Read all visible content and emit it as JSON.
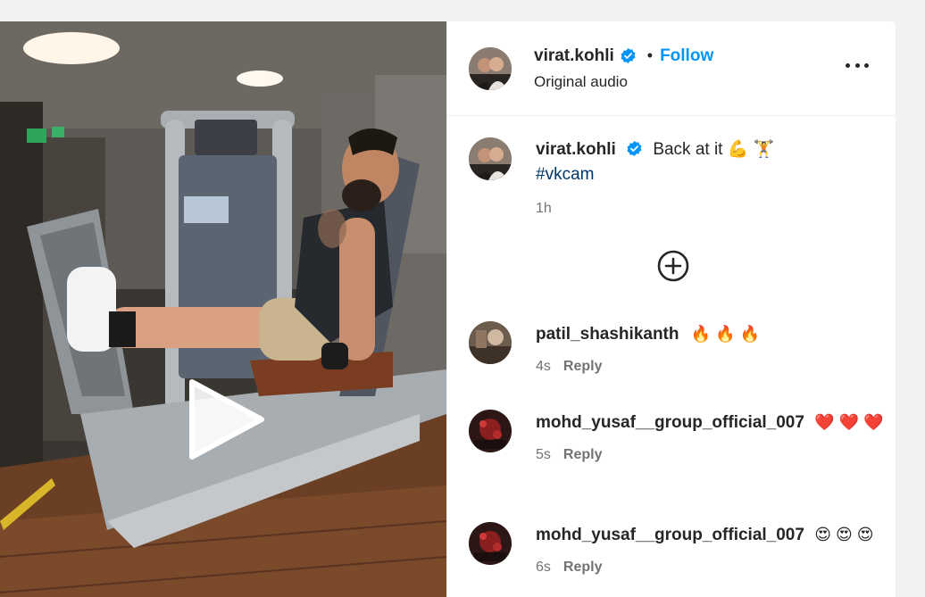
{
  "post": {
    "author": "virat.kohli",
    "follow_label": "Follow",
    "separator": "•",
    "audio": "Original audio",
    "caption": "Back at it 💪 🏋️",
    "hashtag": "#vkcam",
    "time": "1h"
  },
  "comments": [
    {
      "user": "patil_shashikanth",
      "text": "🔥 🔥 🔥",
      "time": "4s",
      "reply_label": "Reply"
    },
    {
      "user": "mohd_yusaf__group_official_007",
      "text": "❤️ ❤️ ❤️",
      "time": "5s",
      "reply_label": "Reply"
    },
    {
      "user": "mohd_yusaf__group_official_007",
      "text": "😍 😍 😍",
      "time": "6s",
      "reply_label": "Reply"
    }
  ],
  "icons": {
    "verified": "verified-badge-icon",
    "more": "more-options-icon",
    "load_more": "plus-circle-icon",
    "play": "play-icon"
  },
  "colors": {
    "follow": "#0095f6",
    "verified": "#0095f6",
    "hashtag": "#00376b",
    "muted": "#737373"
  }
}
